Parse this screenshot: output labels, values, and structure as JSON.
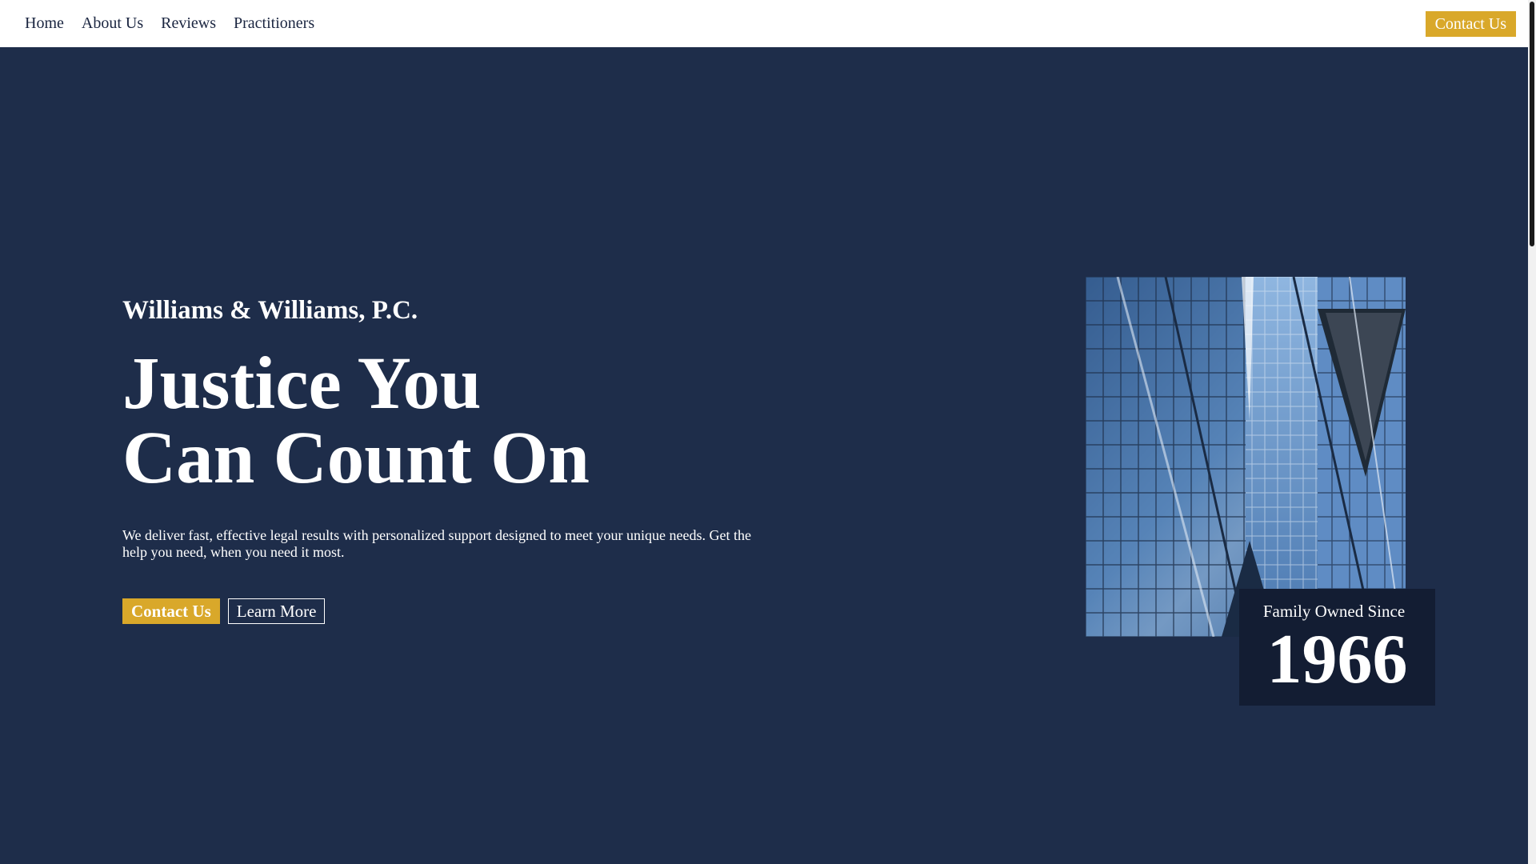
{
  "nav": {
    "links": [
      "Home",
      "About Us",
      "Reviews",
      "Practitioners"
    ],
    "contact_label": "Contact Us"
  },
  "hero": {
    "firm_name": "Williams & Williams, P.C.",
    "headline_line1": "Justice You",
    "headline_line2": "Can Count On",
    "description": "We deliver fast, effective legal results with personalized support designed to meet your unique needs. Get the help you need, when you need it most.",
    "primary_button": "Contact Us",
    "secondary_button": "Learn More"
  },
  "badge": {
    "label": "Family Owned Since",
    "year": "1966"
  },
  "image": {
    "subject": "glass office building"
  },
  "colors": {
    "background": "#1e2d4a",
    "accent": "#d9a82a",
    "badge_background": "#131d33"
  }
}
